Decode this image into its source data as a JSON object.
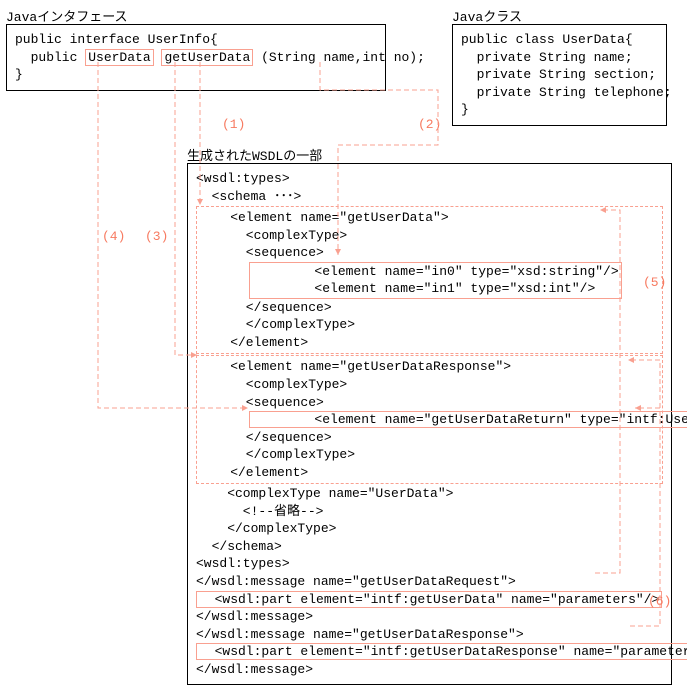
{
  "labels": {
    "interface": "Javaインタフェース",
    "class": "Javaクラス",
    "wsdl": "生成されたWSDLの一部"
  },
  "interface": {
    "l1_pre": "public interface UserInfo{",
    "l2_pre": "  public ",
    "l2_ret": "UserData",
    "l2_mid": " ",
    "l2_method": "getUserData",
    "l2_post": " (String name,int no);",
    "l3": "}"
  },
  "class_code": {
    "l1": "public class UserData{",
    "l2": "  private String name;",
    "l3": "  private String section;",
    "l4": "  private String telephone;",
    "l5": "}"
  },
  "wsdl": {
    "l1": "<wsdl:types>",
    "l2": "  <schema ･･･>",
    "l3": "    <element name=\"getUserData\">",
    "l4": "      <complexType>",
    "l5": "      <sequence>",
    "l6": "        <element name=\"in0\" type=\"xsd:string\"/>",
    "l7": "        <element name=\"in1\" type=\"xsd:int\"/>",
    "l8": "      </sequence>",
    "l9": "      </complexType>",
    "l10": "    </element>",
    "l11": "    <element name=\"getUserDataResponse\">",
    "l12": "      <complexType>",
    "l13": "      <sequence>",
    "l14": "        <element name=\"getUserDataReturn\" type=\"intf:UserData\"/>",
    "l15": "      </sequence>",
    "l16": "      </complexType>",
    "l17": "    </element>",
    "l18": "    <complexType name=\"UserData\">",
    "l19": "      <!--省略-->",
    "l20": "    </complexType>",
    "l21": "  </schema>",
    "l22": "<wsdl:types>",
    "l23": "</wsdl:message name=\"getUserDataRequest\">",
    "l24": "  <wsdl:part element=\"intf:getUserData\" name=\"parameters\"/>",
    "l25": "</wsdl:message>",
    "l26": "</wsdl:message name=\"getUserDataResponse\">",
    "l27": "  <wsdl:part element=\"intf:getUserDataResponse\" name=\"parameters\"/>",
    "l28": "</wsdl:message>"
  },
  "nums": {
    "n1": "(1)",
    "n2": "(2)",
    "n3": "(3)",
    "n4": "(4)",
    "n5": "(5)",
    "n6": "(6)"
  }
}
